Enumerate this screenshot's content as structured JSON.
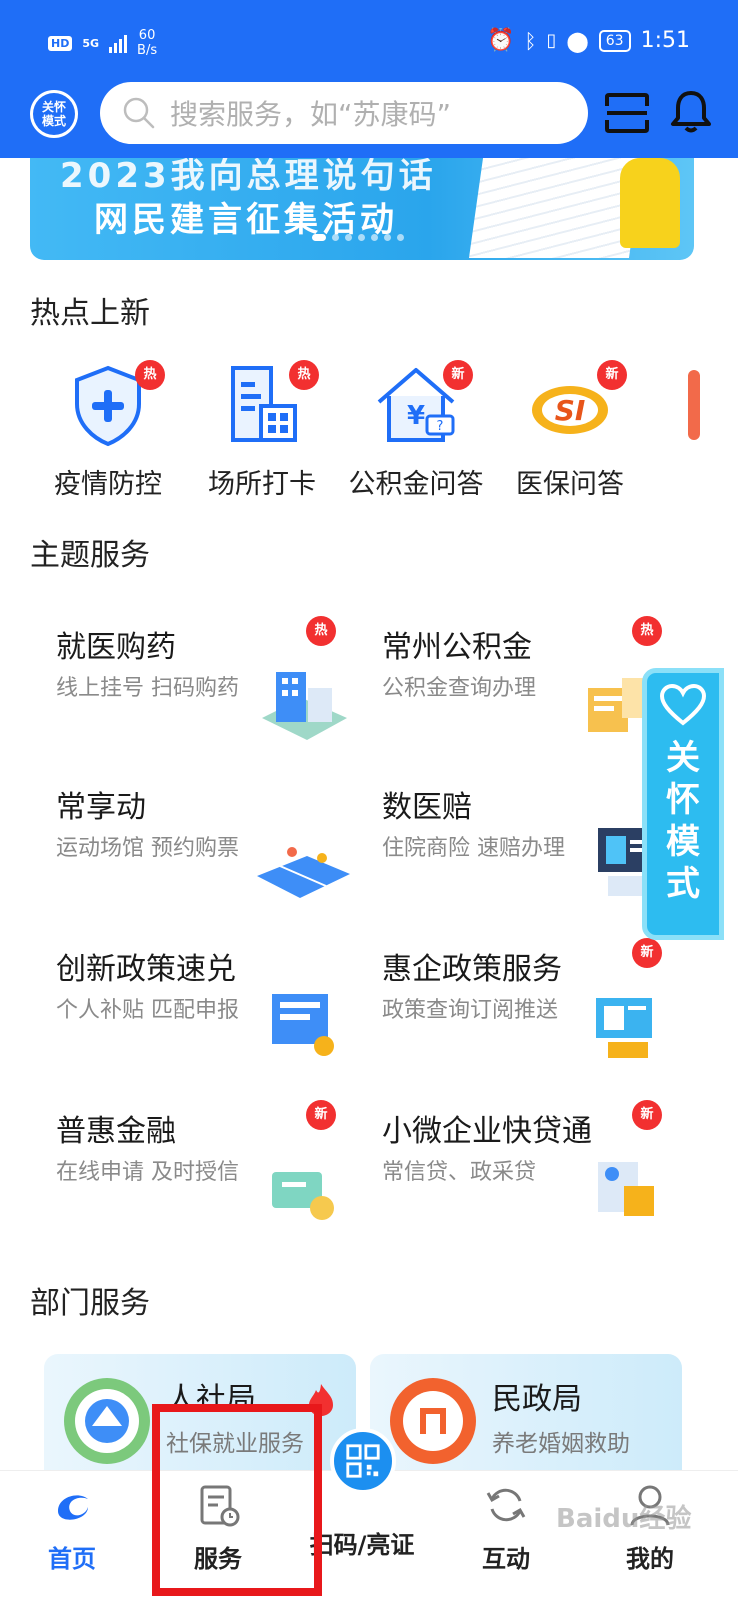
{
  "status_bar": {
    "hd": "HD",
    "net": "5G",
    "speed_value": "60",
    "speed_unit": "B/s",
    "battery": "63",
    "time": "1:51"
  },
  "header": {
    "care_mode_label": "关怀模式",
    "search_placeholder": "搜索服务，如“苏康码”"
  },
  "banner": {
    "line1": "2023我向总理说句话",
    "line2": "网民建言征集活动"
  },
  "hot_new": {
    "title": "热点上新",
    "items": [
      {
        "label": "疫情防控",
        "badge": "热",
        "icon": "shield-plus-icon"
      },
      {
        "label": "场所打卡",
        "badge": "热",
        "icon": "building-qr-icon"
      },
      {
        "label": "公积金问答",
        "badge": "新",
        "icon": "house-yuan-icon"
      },
      {
        "label": "医保问答",
        "badge": "新",
        "icon": "si-logo-icon"
      }
    ]
  },
  "themes": {
    "title": "主题服务",
    "items": [
      {
        "name": "就医购药",
        "desc": "线上挂号 扫码购药",
        "badge": "热"
      },
      {
        "name": "常州公积金",
        "desc": "公积金查询办理",
        "badge": "热"
      },
      {
        "name": "常享动",
        "desc": "运动场馆 预约购票",
        "badge": ""
      },
      {
        "name": "数医赔",
        "desc": "住院商险 速赔办理",
        "badge": ""
      },
      {
        "name": "创新政策速兑",
        "desc": "个人补贴 匹配申报",
        "badge": ""
      },
      {
        "name": "惠企政策服务",
        "desc": "政策查询订阅推送",
        "badge": "新"
      },
      {
        "name": "普惠金融",
        "desc": "在线申请 及时授信",
        "badge": "新"
      },
      {
        "name": "小微企业快贷通",
        "desc": "常信贷、政采贷",
        "badge": "新"
      }
    ]
  },
  "care_float": {
    "c1": "关",
    "c2": "怀",
    "c3": "模",
    "c4": "式"
  },
  "departments": {
    "title": "部门服务",
    "items": [
      {
        "name": "人社局",
        "desc": "社保就业服务"
      },
      {
        "name": "民政局",
        "desc": "养老婚姻救助"
      }
    ]
  },
  "bottom_nav": {
    "items": [
      {
        "label": "首页",
        "active": true
      },
      {
        "label": "服务",
        "active": false
      },
      {
        "label": "扫码/亮证",
        "active": false
      },
      {
        "label": "互动",
        "active": false
      },
      {
        "label": "我的",
        "active": false
      }
    ]
  },
  "watermark": "Baidu经验",
  "colors": {
    "primary": "#1f6ef7",
    "badge_red": "#f23030",
    "highlight_red": "#e8181b"
  }
}
